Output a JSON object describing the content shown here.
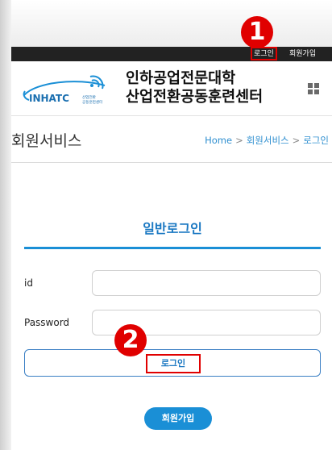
{
  "topbar": {
    "login_label": "로그인",
    "join_label": "회원가입"
  },
  "header": {
    "logo_text": "INHATC",
    "logo_subtext_line1": "산업전환",
    "logo_subtext_line2": "공동훈련센터",
    "title_line1": "인하공업전문대학",
    "title_line2": "산업전환공동훈련센터"
  },
  "subhead": {
    "section_title": "회원서비스",
    "breadcrumb": [
      "Home",
      "회원서비스",
      "로그인"
    ],
    "separator": ">"
  },
  "login_form": {
    "title": "일반로그인",
    "id_label": "id",
    "id_value": "",
    "password_label": "Password",
    "password_value": "",
    "login_button_label": "로그인",
    "join_button_label": "회원가입"
  },
  "markers": [
    "1",
    "2"
  ],
  "colors": {
    "accent": "#1a8fd6",
    "highlight": "#e00000",
    "topbar": "#222222"
  }
}
